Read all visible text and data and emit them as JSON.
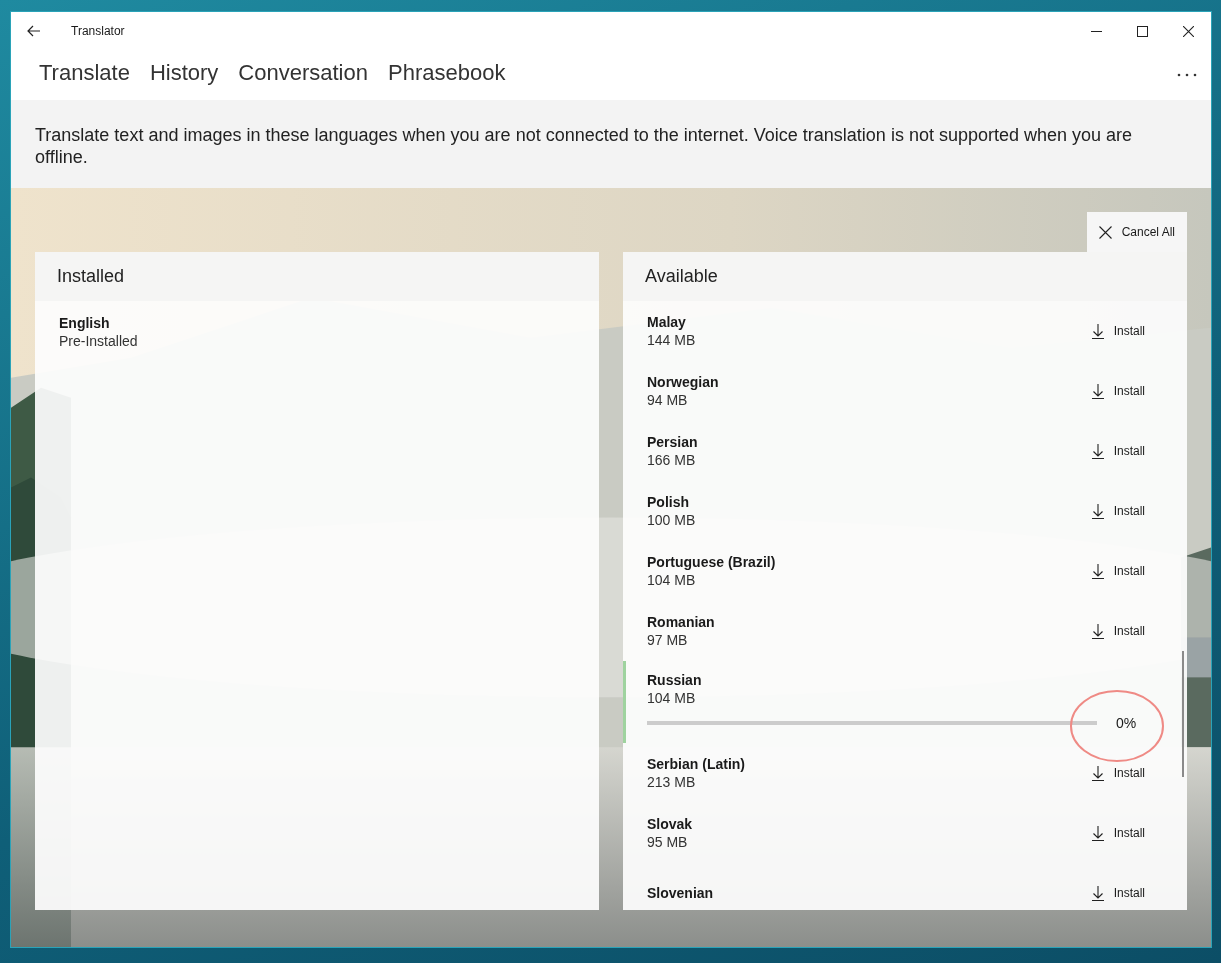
{
  "window": {
    "title": "Translator"
  },
  "tabs": [
    "Translate",
    "History",
    "Conversation",
    "Phrasebook"
  ],
  "info": "Translate text and images in these languages when you are not connected to the internet. Voice translation is not supported when you are offline.",
  "cancel_all": "Cancel All",
  "installed": {
    "heading": "Installed",
    "items": [
      {
        "name": "English",
        "status": "Pre-Installed"
      }
    ]
  },
  "available": {
    "heading": "Available",
    "items": [
      {
        "kind": "install",
        "name": "Malay",
        "size": "144 MB",
        "action": "Install"
      },
      {
        "kind": "install",
        "name": "Norwegian",
        "size": "94 MB",
        "action": "Install"
      },
      {
        "kind": "install",
        "name": "Persian",
        "size": "166 MB",
        "action": "Install"
      },
      {
        "kind": "install",
        "name": "Polish",
        "size": "100 MB",
        "action": "Install"
      },
      {
        "kind": "install",
        "name": "Portuguese (Brazil)",
        "size": "104 MB",
        "action": "Install"
      },
      {
        "kind": "install",
        "name": "Romanian",
        "size": "97 MB",
        "action": "Install"
      },
      {
        "kind": "downloading",
        "name": "Russian",
        "size": "104 MB",
        "level": 0,
        "reading": "0%",
        "circled": true
      },
      {
        "kind": "install",
        "name": "Serbian (Latin)",
        "size": "213 MB",
        "action": "Install"
      },
      {
        "kind": "install",
        "name": "Slovak",
        "size": "95 MB",
        "action": "Install"
      },
      {
        "kind": "install",
        "name": "Slovenian",
        "action": "Install"
      }
    ]
  }
}
